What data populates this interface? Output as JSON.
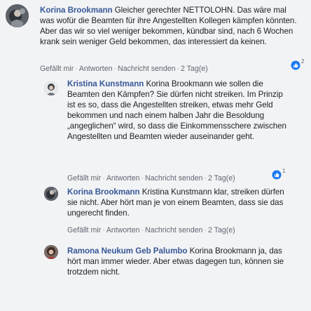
{
  "comments": [
    {
      "author": "Korina Brookmann",
      "text": "Gleicher gerechter NETTOLOHN. Das wäre mal was wofür die Beamten für ihre Angestellten Kollegen kämpfen könnten. Aber das wir so viel weniger bekommen, kündbar sind, nach 6 Wochen krank sein weniger Geld bekommen, das interessiert da keinen.",
      "like_label": "Gefällt mir",
      "reply_label": "Antworten",
      "message_label": "Nachricht senden",
      "time": "2 Tag(e)",
      "reaction_count": "2"
    },
    {
      "author": "Kristina Kunstmann",
      "text": "Korina Brookmann wie sollen die Beamten den Kämpfen? Sie dürfen nicht streiken. Im Prinzip ist es so, dass die Angestellten streiken, etwas mehr Geld bekommen und nach einem halben Jahr die Besoldung „angeglichen“ wird, so dass die Einkommensschere zwischen Angestellten und Beamten wieder auseinander geht.",
      "like_label": "Gefällt mir",
      "reply_label": "Antworten",
      "message_label": "Nachricht senden",
      "time": "2 Tag(e)",
      "reaction_count": "1"
    },
    {
      "author": "Korina Brookmann",
      "text": "Kristina Kunstmann klar, streiken dürfen sie nicht. Aber hört man je von einem Beamten, dass sie das ungerecht finden.",
      "like_label": "Gefällt mir",
      "reply_label": "Antworten",
      "message_label": "Nachricht senden",
      "time": "2 Tag(e)"
    },
    {
      "author": "Ramona Neukum Geb Palumbo",
      "text": "Korina Brookmann ja, das hört man immer wieder. Aber etwas dagegen tun, können sie trotzdem nicht."
    }
  ],
  "colors": {
    "background": "#f2f3f5",
    "author": "#385898",
    "text": "#1c1e21",
    "meta": "#606770",
    "like_badge": "#1877f2"
  },
  "icons": {
    "reaction": "like-thumb-icon"
  }
}
